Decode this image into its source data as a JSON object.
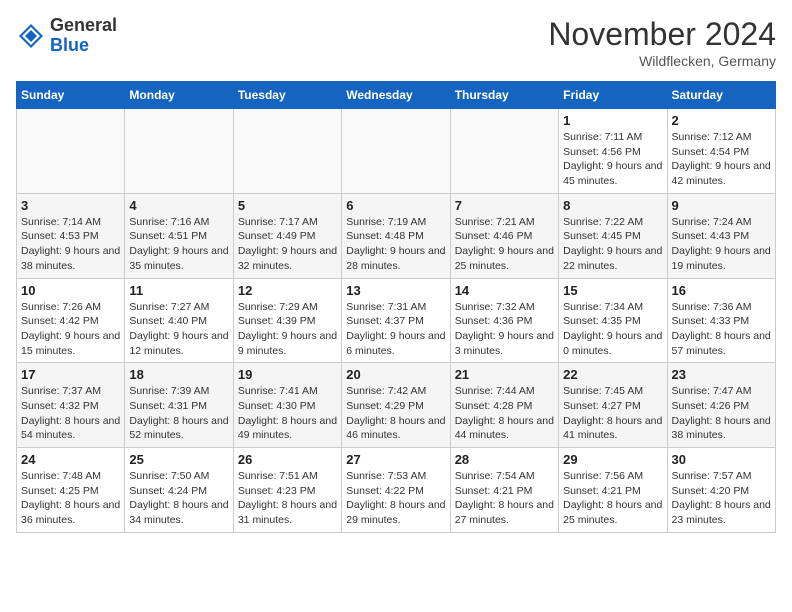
{
  "header": {
    "logo_general": "General",
    "logo_blue": "Blue",
    "month_title": "November 2024",
    "location": "Wildflecken, Germany"
  },
  "calendar": {
    "days_of_week": [
      "Sunday",
      "Monday",
      "Tuesday",
      "Wednesday",
      "Thursday",
      "Friday",
      "Saturday"
    ],
    "weeks": [
      [
        {
          "day": "",
          "info": ""
        },
        {
          "day": "",
          "info": ""
        },
        {
          "day": "",
          "info": ""
        },
        {
          "day": "",
          "info": ""
        },
        {
          "day": "",
          "info": ""
        },
        {
          "day": "1",
          "info": "Sunrise: 7:11 AM\nSunset: 4:56 PM\nDaylight: 9 hours and 45 minutes."
        },
        {
          "day": "2",
          "info": "Sunrise: 7:12 AM\nSunset: 4:54 PM\nDaylight: 9 hours and 42 minutes."
        }
      ],
      [
        {
          "day": "3",
          "info": "Sunrise: 7:14 AM\nSunset: 4:53 PM\nDaylight: 9 hours and 38 minutes."
        },
        {
          "day": "4",
          "info": "Sunrise: 7:16 AM\nSunset: 4:51 PM\nDaylight: 9 hours and 35 minutes."
        },
        {
          "day": "5",
          "info": "Sunrise: 7:17 AM\nSunset: 4:49 PM\nDaylight: 9 hours and 32 minutes."
        },
        {
          "day": "6",
          "info": "Sunrise: 7:19 AM\nSunset: 4:48 PM\nDaylight: 9 hours and 28 minutes."
        },
        {
          "day": "7",
          "info": "Sunrise: 7:21 AM\nSunset: 4:46 PM\nDaylight: 9 hours and 25 minutes."
        },
        {
          "day": "8",
          "info": "Sunrise: 7:22 AM\nSunset: 4:45 PM\nDaylight: 9 hours and 22 minutes."
        },
        {
          "day": "9",
          "info": "Sunrise: 7:24 AM\nSunset: 4:43 PM\nDaylight: 9 hours and 19 minutes."
        }
      ],
      [
        {
          "day": "10",
          "info": "Sunrise: 7:26 AM\nSunset: 4:42 PM\nDaylight: 9 hours and 15 minutes."
        },
        {
          "day": "11",
          "info": "Sunrise: 7:27 AM\nSunset: 4:40 PM\nDaylight: 9 hours and 12 minutes."
        },
        {
          "day": "12",
          "info": "Sunrise: 7:29 AM\nSunset: 4:39 PM\nDaylight: 9 hours and 9 minutes."
        },
        {
          "day": "13",
          "info": "Sunrise: 7:31 AM\nSunset: 4:37 PM\nDaylight: 9 hours and 6 minutes."
        },
        {
          "day": "14",
          "info": "Sunrise: 7:32 AM\nSunset: 4:36 PM\nDaylight: 9 hours and 3 minutes."
        },
        {
          "day": "15",
          "info": "Sunrise: 7:34 AM\nSunset: 4:35 PM\nDaylight: 9 hours and 0 minutes."
        },
        {
          "day": "16",
          "info": "Sunrise: 7:36 AM\nSunset: 4:33 PM\nDaylight: 8 hours and 57 minutes."
        }
      ],
      [
        {
          "day": "17",
          "info": "Sunrise: 7:37 AM\nSunset: 4:32 PM\nDaylight: 8 hours and 54 minutes."
        },
        {
          "day": "18",
          "info": "Sunrise: 7:39 AM\nSunset: 4:31 PM\nDaylight: 8 hours and 52 minutes."
        },
        {
          "day": "19",
          "info": "Sunrise: 7:41 AM\nSunset: 4:30 PM\nDaylight: 8 hours and 49 minutes."
        },
        {
          "day": "20",
          "info": "Sunrise: 7:42 AM\nSunset: 4:29 PM\nDaylight: 8 hours and 46 minutes."
        },
        {
          "day": "21",
          "info": "Sunrise: 7:44 AM\nSunset: 4:28 PM\nDaylight: 8 hours and 44 minutes."
        },
        {
          "day": "22",
          "info": "Sunrise: 7:45 AM\nSunset: 4:27 PM\nDaylight: 8 hours and 41 minutes."
        },
        {
          "day": "23",
          "info": "Sunrise: 7:47 AM\nSunset: 4:26 PM\nDaylight: 8 hours and 38 minutes."
        }
      ],
      [
        {
          "day": "24",
          "info": "Sunrise: 7:48 AM\nSunset: 4:25 PM\nDaylight: 8 hours and 36 minutes."
        },
        {
          "day": "25",
          "info": "Sunrise: 7:50 AM\nSunset: 4:24 PM\nDaylight: 8 hours and 34 minutes."
        },
        {
          "day": "26",
          "info": "Sunrise: 7:51 AM\nSunset: 4:23 PM\nDaylight: 8 hours and 31 minutes."
        },
        {
          "day": "27",
          "info": "Sunrise: 7:53 AM\nSunset: 4:22 PM\nDaylight: 8 hours and 29 minutes."
        },
        {
          "day": "28",
          "info": "Sunrise: 7:54 AM\nSunset: 4:21 PM\nDaylight: 8 hours and 27 minutes."
        },
        {
          "day": "29",
          "info": "Sunrise: 7:56 AM\nSunset: 4:21 PM\nDaylight: 8 hours and 25 minutes."
        },
        {
          "day": "30",
          "info": "Sunrise: 7:57 AM\nSunset: 4:20 PM\nDaylight: 8 hours and 23 minutes."
        }
      ]
    ]
  }
}
